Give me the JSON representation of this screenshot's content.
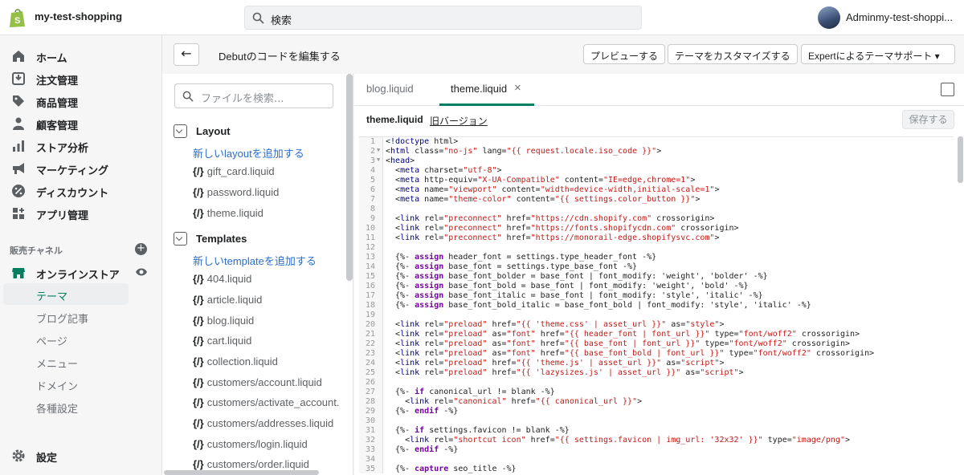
{
  "topbar": {
    "store_name": "my-test-shopping",
    "search_placeholder": "検索",
    "account_name": "Adminmy-test-shoppi..."
  },
  "nav": {
    "items": [
      {
        "label": "ホーム",
        "icon": "home-icon"
      },
      {
        "label": "注文管理",
        "icon": "orders-icon"
      },
      {
        "label": "商品管理",
        "icon": "tag-icon"
      },
      {
        "label": "顧客管理",
        "icon": "customer-icon"
      },
      {
        "label": "ストア分析",
        "icon": "analytics-icon"
      },
      {
        "label": "マーケティング",
        "icon": "marketing-icon"
      },
      {
        "label": "ディスカウント",
        "icon": "discount-icon"
      },
      {
        "label": "アプリ管理",
        "icon": "apps-icon"
      }
    ],
    "channels_heading": "販売チャネル",
    "online_store": "オンラインストア",
    "sub_items": [
      "テーマ",
      "ブログ記事",
      "ページ",
      "メニュー",
      "ドメイン",
      "各種設定"
    ],
    "settings": "設定"
  },
  "header": {
    "back": "←",
    "title": "Debutのコードを編集する",
    "preview": "プレビューする",
    "customize": "テーマをカスタマイズする",
    "expert": "Expertによるテーマサポート ▾"
  },
  "files": {
    "search_placeholder": "ファイルを検索...",
    "layout": {
      "label": "Layout",
      "add": "新しいlayoutを追加する",
      "files": [
        "gift_card.liquid",
        "password.liquid",
        "theme.liquid"
      ]
    },
    "templates": {
      "label": "Templates",
      "add": "新しいtemplateを追加する",
      "files": [
        "404.liquid",
        "article.liquid",
        "blog.liquid",
        "cart.liquid",
        "collection.liquid",
        "customers/account.liquid",
        "customers/activate_account.",
        "customers/addresses.liquid",
        "customers/login.liquid",
        "customers/order.liquid"
      ]
    }
  },
  "editor": {
    "tabs": [
      "blog.liquid",
      "theme.liquid"
    ],
    "close": "×",
    "file_name": "theme.liquid",
    "old_version": "旧バージョン",
    "save": "保存する",
    "lines": [
      "<!doctype html>",
      "<html class=\"no-js\" lang=\"{{ request.locale.iso_code }}\">",
      "<head>",
      "  <meta charset=\"utf-8\">",
      "  <meta http-equiv=\"X-UA-Compatible\" content=\"IE=edge,chrome=1\">",
      "  <meta name=\"viewport\" content=\"width=device-width,initial-scale=1\">",
      "  <meta name=\"theme-color\" content=\"{{ settings.color_button }}\">",
      "",
      "  <link rel=\"preconnect\" href=\"https://cdn.shopify.com\" crossorigin>",
      "  <link rel=\"preconnect\" href=\"https://fonts.shopifycdn.com\" crossorigin>",
      "  <link rel=\"preconnect\" href=\"https://monorail-edge.shopifysvc.com\">",
      "",
      "  {%- assign header_font = settings.type_header_font -%}",
      "  {%- assign base_font = settings.type_base_font -%}",
      "  {%- assign base_font_bolder = base_font | font_modify: 'weight', 'bolder' -%}",
      "  {%- assign base_font_bold = base_font | font_modify: 'weight', 'bold' -%}",
      "  {%- assign base_font_italic = base_font | font_modify: 'style', 'italic' -%}",
      "  {%- assign base_font_bold_italic = base_font_bold | font_modify: 'style', 'italic' -%}",
      "",
      "  <link rel=\"preload\" href=\"{{ 'theme.css' | asset_url }}\" as=\"style\">",
      "  <link rel=\"preload\" as=\"font\" href=\"{{ header_font | font_url }}\" type=\"font/woff2\" crossorigin>",
      "  <link rel=\"preload\" as=\"font\" href=\"{{ base_font | font_url }}\" type=\"font/woff2\" crossorigin>",
      "  <link rel=\"preload\" as=\"font\" href=\"{{ base_font_bold | font_url }}\" type=\"font/woff2\" crossorigin>",
      "  <link rel=\"preload\" href=\"{{ 'theme.js' | asset_url }}\" as=\"script\">",
      "  <link rel=\"preload\" href=\"{{ 'lazysizes.js' | asset_url }}\" as=\"script\">",
      "",
      "  {%- if canonical_url != blank -%}",
      "    <link rel=\"canonical\" href=\"{{ canonical_url }}\">",
      "  {%- endif -%}",
      "",
      "  {%- if settings.favicon != blank -%}",
      "    <link rel=\"shortcut icon\" href=\"{{ settings.favicon | img_url: '32x32' }}\" type=\"image/png\">",
      "  {%- endif -%}",
      "",
      "  {%- capture seo_title -%}"
    ]
  },
  "colors": {
    "accent": "#008060",
    "link": "#2c6ecb",
    "tag": "#000080",
    "attr": "#994500",
    "string": "#c41a16",
    "keyword": "#7a00a3"
  }
}
